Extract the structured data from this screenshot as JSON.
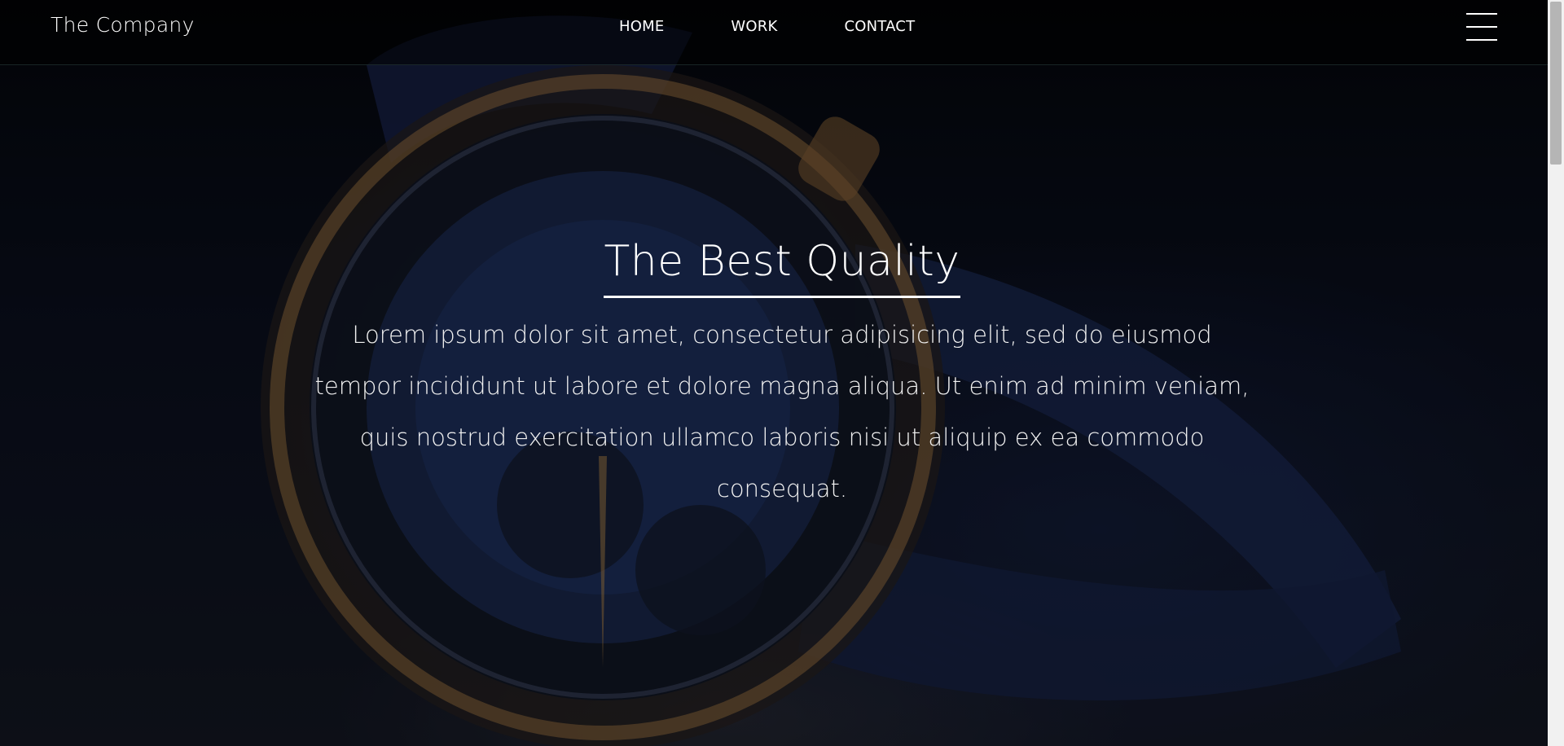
{
  "header": {
    "brand": "The Company",
    "nav": [
      {
        "label": "HOME"
      },
      {
        "label": "WORK"
      },
      {
        "label": "CONTACT"
      }
    ],
    "menu_icon": "hamburger-icon"
  },
  "hero": {
    "title": "The Best Quality",
    "body": "Lorem ipsum dolor sit amet, consectetur adipisicing elit, sed do eiusmod tempor incididunt ut labore et dolore magna aliqua. Ut enim ad minim veniam, quis nostrud exercitation ullamco laboris nisi ut aliquip ex ea commodo consequat.",
    "background_image": "luxury-watch-photo"
  },
  "colors": {
    "text": "#ffffff",
    "header_bg": "#000000",
    "accent_gold": "#b8894a",
    "watch_blue": "#1f2f5c"
  }
}
